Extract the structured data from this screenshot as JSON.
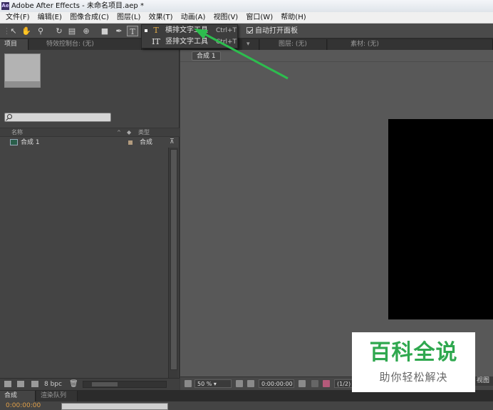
{
  "window": {
    "title": "Adobe After Effects - 未命名项目.aep *",
    "app_icon": "Ae"
  },
  "menu": [
    "文件(F)",
    "编辑(E)",
    "图像合成(C)",
    "图层(L)",
    "效果(T)",
    "动画(A)",
    "视图(V)",
    "窗口(W)",
    "帮助(H)"
  ],
  "toolbar": {
    "auto_open_label": "自动打开面板",
    "auto_open_checked": true,
    "text_tool_glyph": "T"
  },
  "text_tool_menu": {
    "items": [
      {
        "icon": "T",
        "label": "横排文字工具",
        "shortcut": "Ctrl+T",
        "selected": true
      },
      {
        "icon": "IT",
        "label": "竖排文字工具",
        "shortcut": "Ctrl+T",
        "selected": false
      }
    ]
  },
  "top_tabs": {
    "project": "项目",
    "effects": "特效控制台: (无)",
    "layer": "图层: (无)",
    "footage": "素材: (无)"
  },
  "project_panel": {
    "columns": {
      "name": "名称",
      "type": "类型"
    },
    "items": [
      {
        "name": "合成 1",
        "type": "合成"
      }
    ],
    "bpc": "8 bpc"
  },
  "composition_viewer": {
    "comp_tab": "合成 1",
    "zoom": "50 %",
    "timecode": "0:00:00:00",
    "resolution": "(1/2)",
    "view_label": "视图"
  },
  "bottom_tabs": {
    "composition": "合成 1",
    "render_queue": "渲染队列"
  },
  "timeline": {
    "timecode": "0:00:00:00"
  },
  "watermark": {
    "title": "百科全说",
    "subtitle": "助你轻松解决"
  },
  "colors": {
    "annotation_arrow": "#2dbd4e",
    "watermark_green": "#2fa84f",
    "timecode_orange": "#e0a04a"
  }
}
